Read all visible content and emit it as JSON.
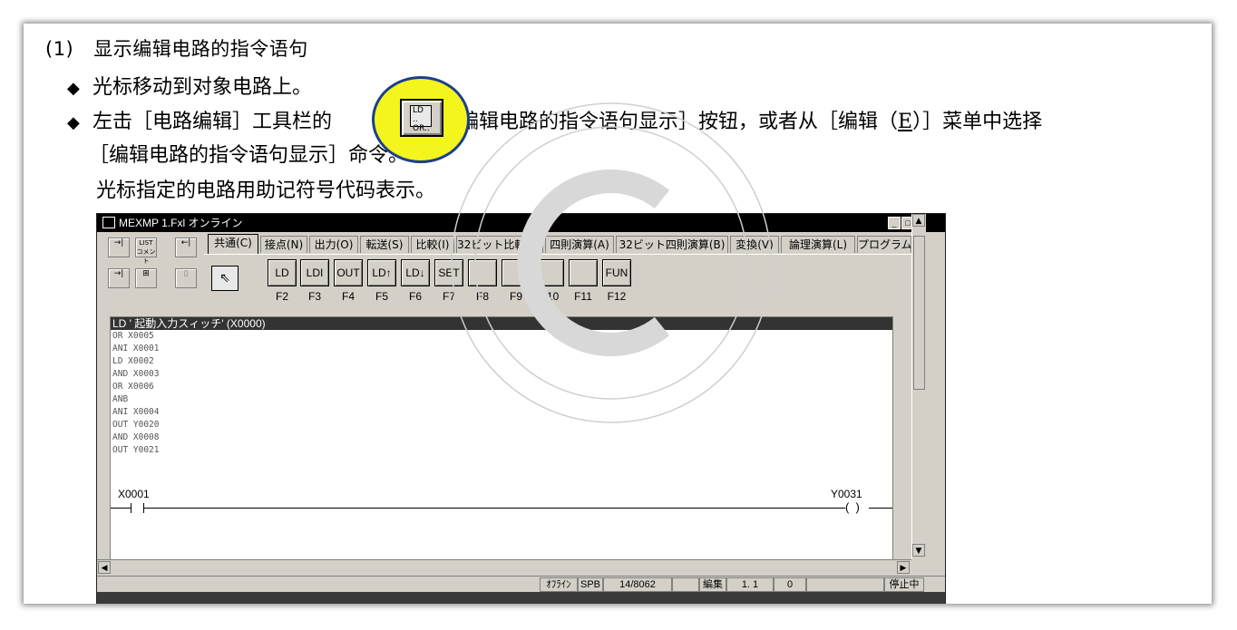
{
  "doc": {
    "heading_num": "(1)",
    "heading_text": "显示编辑电路的指令语句",
    "bullet1": "光标移动到对象电路上。",
    "bullet2_a": "左击［电路编辑］工具栏的",
    "bullet2_b": "［编辑电路的指令语句显示］按钮，或者从［编辑（",
    "bullet2_e": "E",
    "bullet2_c": "）］菜单中选择",
    "line3": "［编辑电路的指令语句显示］命令。",
    "line4": "光标指定的电路用助记符号代码表示。",
    "lens_icon_text": "LD ..\nOR.."
  },
  "window": {
    "title": "MEXMP 1.Fxl オンライン",
    "tabs": [
      "共通(C)",
      "接点(N)",
      "出力(O)",
      "転送(S)",
      "比較(I)",
      "32ビット比較(D)",
      "四則演算(A)",
      "32ビット四則演算(B)",
      "変換(V)",
      "論理演算(L)",
      "プログラム"
    ],
    "left_tools": {
      "t1": "→|",
      "t2": "LIST\nコメント",
      "t3": "←|",
      "t4": "→|",
      "t5": "⊞",
      "t6": "▯"
    },
    "pointer_glyph": "⇖",
    "fkeys": [
      {
        "label": "LD",
        "key": "F2"
      },
      {
        "label": "LDI",
        "key": "F3"
      },
      {
        "label": "OUT",
        "key": "F4"
      },
      {
        "label": "LD↑",
        "key": "F5"
      },
      {
        "label": "LD↓",
        "key": "F6"
      },
      {
        "label": "SET",
        "key": "F7"
      },
      {
        "label": "",
        "key": "F8"
      },
      {
        "label": "",
        "key": "F9"
      },
      {
        "label": "",
        "key": "F10"
      },
      {
        "label": "",
        "key": "F11"
      },
      {
        "label": "FUN",
        "key": "F12"
      }
    ],
    "instructions": {
      "highlight": "LD ' 起動入力スィッチ' (X0000)",
      "lines": [
        "OR X0005",
        "ANI X0001",
        "LD X0002",
        "AND X0003",
        "OR X0006",
        "ANB",
        "ANI X0004",
        "OUT Y0020",
        "AND X0008",
        "OUT Y0021"
      ]
    },
    "ladder": {
      "contact_label": "X0001",
      "coil_label": "Y0031"
    },
    "status": [
      "ｵﾌﾗｲﾝ",
      "SPB",
      "14/8062",
      "",
      "編集",
      "1. 1",
      "0",
      "",
      "停止中"
    ]
  }
}
